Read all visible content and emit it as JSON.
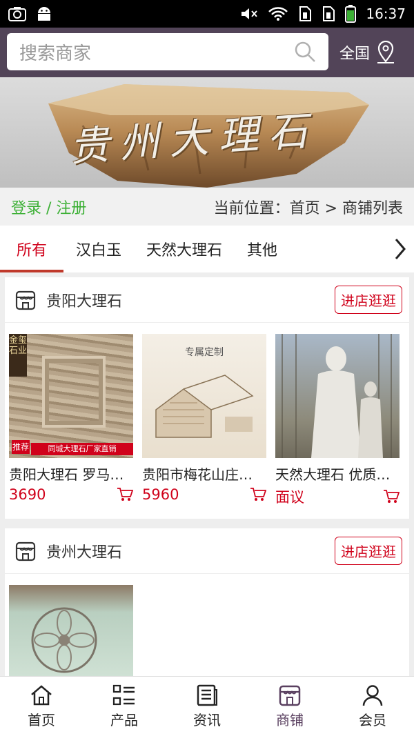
{
  "status_bar": {
    "time": "16:37"
  },
  "search": {
    "placeholder": "搜索商家",
    "region_label": "全国"
  },
  "banner": {
    "title": "贵州大理石"
  },
  "crumb": {
    "login": "登录 / 注册",
    "location": "当前位置：首页 > 商铺列表"
  },
  "tabs": [
    {
      "label": "所有",
      "active": true
    },
    {
      "label": "汉白玉"
    },
    {
      "label": "天然大理石"
    },
    {
      "label": "其他"
    }
  ],
  "shops": [
    {
      "name": "贵阳大理石",
      "enter_label": "进店逛逛",
      "products": [
        {
          "title": "贵阳大理石 罗马…",
          "price": "3690",
          "img_badge": "同城大理石厂家直销",
          "img_tag": "金玺石业",
          "img_rec": "推荐"
        },
        {
          "title": "贵阳市梅花山庄…",
          "price": "5960",
          "img_caption": "专属定制"
        },
        {
          "title": "天然大理石 优质…",
          "price": "面议"
        }
      ]
    },
    {
      "name": "贵州大理石",
      "enter_label": "进店逛逛",
      "products": []
    }
  ],
  "bottom_nav": [
    {
      "label": "首页",
      "icon": "home-icon"
    },
    {
      "label": "产品",
      "icon": "list-icon"
    },
    {
      "label": "资讯",
      "icon": "news-icon"
    },
    {
      "label": "商铺",
      "icon": "shop-icon",
      "active": true
    },
    {
      "label": "会员",
      "icon": "user-icon"
    }
  ],
  "colors": {
    "header": "#524458",
    "accent": "#d0021b",
    "login": "#3cb035"
  }
}
